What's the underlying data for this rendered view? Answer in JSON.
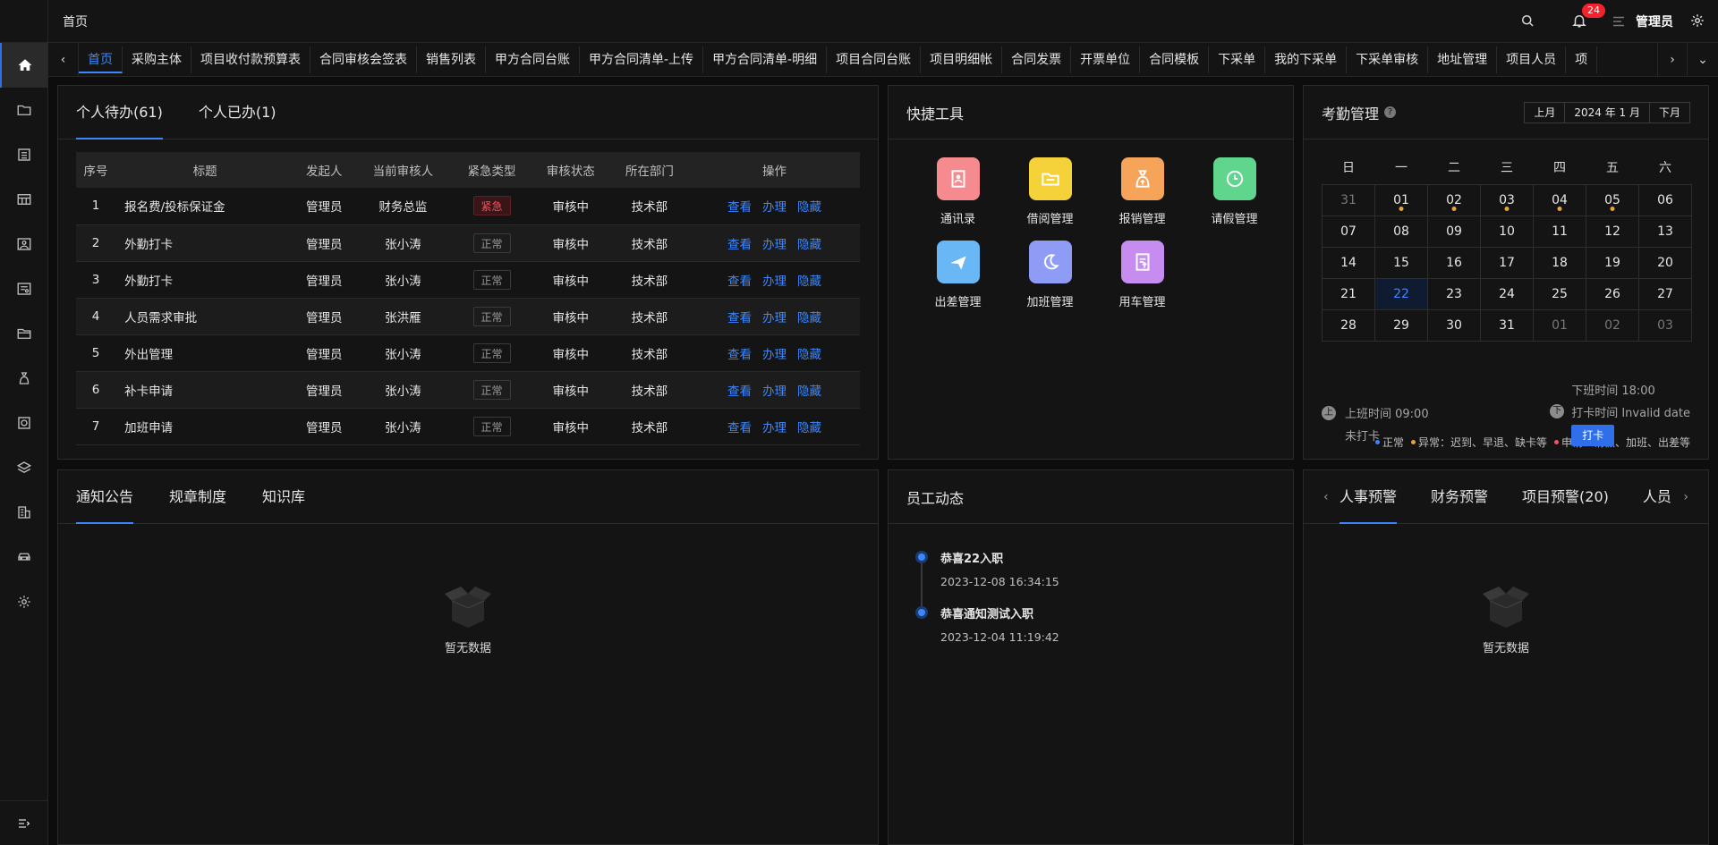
{
  "header": {
    "breadcrumb": "首页",
    "notifications_count": "24",
    "username": "管理员"
  },
  "tabs": [
    "首页",
    "采购主体",
    "项目收付款预算表",
    "合同审核会签表",
    "销售列表",
    "甲方合同台账",
    "甲方合同清单-上传",
    "甲方合同清单-明细",
    "项目合同台账",
    "项目明细帐",
    "合同发票",
    "开票单位",
    "合同模板",
    "下采单",
    "我的下采单",
    "下采单审核",
    "地址管理",
    "项目人员",
    "项"
  ],
  "todo": {
    "tabs": [
      "个人待办(61)",
      "个人已办(1)"
    ],
    "columns": [
      "序号",
      "标题",
      "发起人",
      "当前审核人",
      "紧急类型",
      "审核状态",
      "所在部门",
      "操作"
    ],
    "actions": [
      "查看",
      "办理",
      "隐藏"
    ],
    "rows": [
      {
        "no": "1",
        "title": "报名费/投标保证金",
        "initiator": "管理员",
        "reviewer": "财务总监",
        "urgency": "紧急",
        "status": "审核中",
        "dept": "技术部"
      },
      {
        "no": "2",
        "title": "外勤打卡",
        "initiator": "管理员",
        "reviewer": "张小涛",
        "urgency": "正常",
        "status": "审核中",
        "dept": "技术部"
      },
      {
        "no": "3",
        "title": "外勤打卡",
        "initiator": "管理员",
        "reviewer": "张小涛",
        "urgency": "正常",
        "status": "审核中",
        "dept": "技术部"
      },
      {
        "no": "4",
        "title": "人员需求审批",
        "initiator": "管理员",
        "reviewer": "张洪雁",
        "urgency": "正常",
        "status": "审核中",
        "dept": "技术部"
      },
      {
        "no": "5",
        "title": "外出管理",
        "initiator": "管理员",
        "reviewer": "张小涛",
        "urgency": "正常",
        "status": "审核中",
        "dept": "技术部"
      },
      {
        "no": "6",
        "title": "补卡申请",
        "initiator": "管理员",
        "reviewer": "张小涛",
        "urgency": "正常",
        "status": "审核中",
        "dept": "技术部"
      },
      {
        "no": "7",
        "title": "加班申请",
        "initiator": "管理员",
        "reviewer": "张小涛",
        "urgency": "正常",
        "status": "审核中",
        "dept": "技术部"
      }
    ]
  },
  "quick_tools": {
    "title": "快捷工具",
    "items": [
      {
        "label": "通讯录",
        "color": "#f58a8f",
        "icon": "contact-book-icon"
      },
      {
        "label": "借阅管理",
        "color": "#f5d23a",
        "icon": "folder-icon"
      },
      {
        "label": "报销管理",
        "color": "#f5a45a",
        "icon": "money-bag-icon"
      },
      {
        "label": "请假管理",
        "color": "#5fd58d",
        "icon": "clock-icon"
      },
      {
        "label": "出差管理",
        "color": "#6ab7f5",
        "icon": "plane-icon"
      },
      {
        "label": "加班管理",
        "color": "#8f9cf5",
        "icon": "moon-icon"
      },
      {
        "label": "用车管理",
        "color": "#c78cf0",
        "icon": "document-upload-icon"
      }
    ]
  },
  "attendance": {
    "title": "考勤管理",
    "prev": "上月",
    "month": "2024 年 1 月",
    "next": "下月",
    "weekdays": [
      "日",
      "一",
      "二",
      "三",
      "四",
      "五",
      "六"
    ],
    "weeks": [
      [
        {
          "d": "31",
          "dim": true
        },
        {
          "d": "01",
          "dot": true
        },
        {
          "d": "02",
          "dot": true
        },
        {
          "d": "03",
          "dot": true
        },
        {
          "d": "04",
          "dot": true
        },
        {
          "d": "05",
          "dot": true
        },
        {
          "d": "06"
        }
      ],
      [
        {
          "d": "07"
        },
        {
          "d": "08"
        },
        {
          "d": "09"
        },
        {
          "d": "10"
        },
        {
          "d": "11"
        },
        {
          "d": "12"
        },
        {
          "d": "13"
        }
      ],
      [
        {
          "d": "14"
        },
        {
          "d": "15"
        },
        {
          "d": "16"
        },
        {
          "d": "17"
        },
        {
          "d": "18"
        },
        {
          "d": "19"
        },
        {
          "d": "20"
        }
      ],
      [
        {
          "d": "21"
        },
        {
          "d": "22",
          "today": true
        },
        {
          "d": "23"
        },
        {
          "d": "24"
        },
        {
          "d": "25"
        },
        {
          "d": "26"
        },
        {
          "d": "27"
        }
      ],
      [
        {
          "d": "28"
        },
        {
          "d": "29"
        },
        {
          "d": "30"
        },
        {
          "d": "31"
        },
        {
          "d": "01",
          "dim": true
        },
        {
          "d": "02",
          "dim": true
        },
        {
          "d": "03",
          "dim": true
        }
      ]
    ],
    "legend": [
      {
        "label": "正常",
        "color": "#3c87ff"
      },
      {
        "label": "异常：迟到、早退、缺卡等",
        "color": "#e8a33b"
      },
      {
        "label": "申请：请假、加班、出差等",
        "color": "#f5525c"
      }
    ],
    "on_time": "上班时间 09:00",
    "on_status": "未打卡",
    "off_time": "下班时间 18:00",
    "off_status": "打卡时间 Invalid date",
    "clock_button": "打卡",
    "on_icon_label": "上",
    "off_icon_label": "下"
  },
  "notices": {
    "tabs": [
      "通知公告",
      "规章制度",
      "知识库"
    ],
    "empty": "暂无数据"
  },
  "staff_news": {
    "title": "员工动态",
    "items": [
      {
        "title": "恭喜22入职",
        "time": "2023-12-08 16:34:15"
      },
      {
        "title": "恭喜通知测试入职",
        "time": "2023-12-04 11:19:42"
      }
    ]
  },
  "warnings": {
    "tabs": [
      "人事预警",
      "财务预警",
      "项目预警(20)",
      "人员"
    ],
    "empty": "暂无数据"
  }
}
